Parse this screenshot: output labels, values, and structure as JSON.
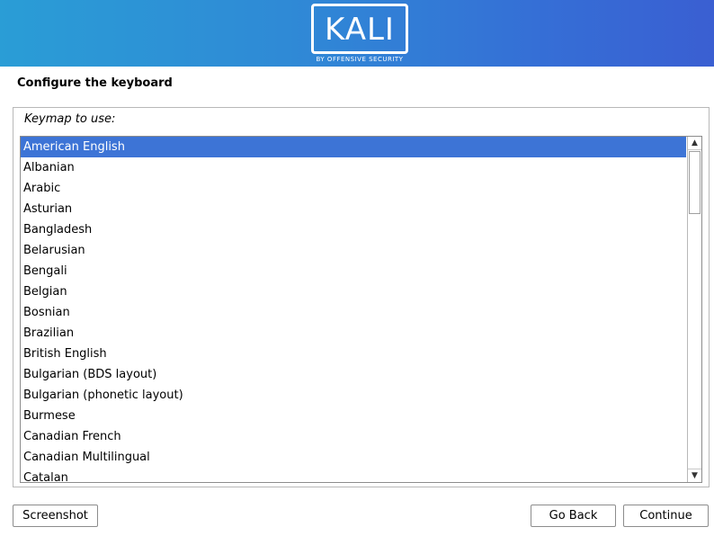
{
  "header": {
    "logo_text": "KALI",
    "logo_subtext": "BY OFFENSIVE SECURITY"
  },
  "page_title": "Configure the keyboard",
  "keymap": {
    "label": "Keymap to use:",
    "selected": "American English",
    "items": [
      "American English",
      "Albanian",
      "Arabic",
      "Asturian",
      "Bangladesh",
      "Belarusian",
      "Bengali",
      "Belgian",
      "Bosnian",
      "Brazilian",
      "British English",
      "Bulgarian (BDS layout)",
      "Bulgarian (phonetic layout)",
      "Burmese",
      "Canadian French",
      "Canadian Multilingual",
      "Catalan"
    ]
  },
  "buttons": {
    "screenshot": "Screenshot",
    "go_back": "Go Back",
    "continue": "Continue"
  },
  "colors": {
    "selection": "#3d74d6",
    "banner_start": "#2a9dd6",
    "banner_end": "#3a5fd2"
  },
  "icons": {
    "scroll_up": "chevron-up-icon",
    "scroll_down": "chevron-down-icon"
  }
}
